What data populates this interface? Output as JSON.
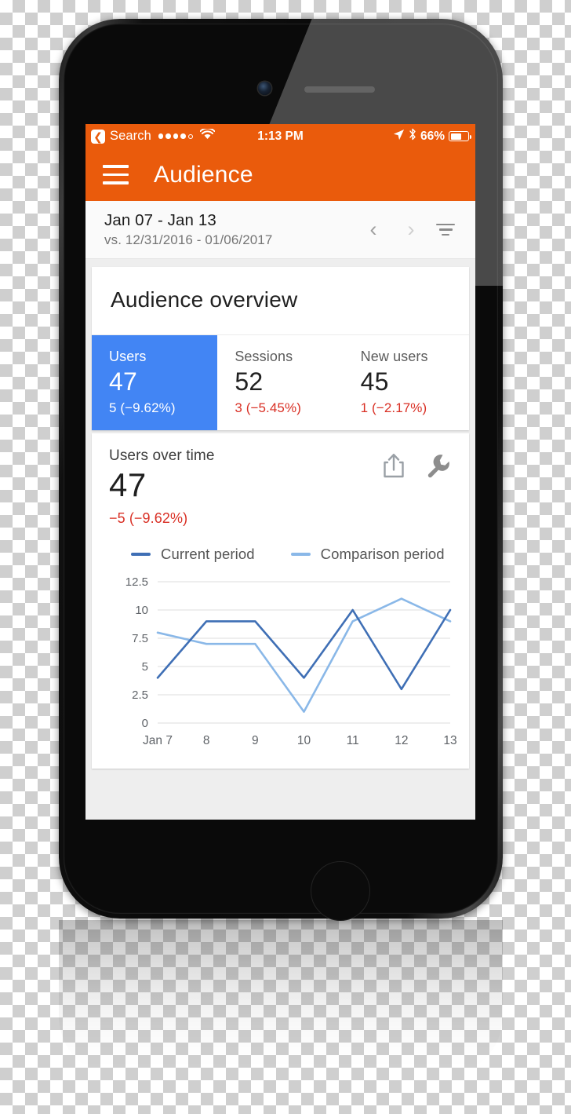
{
  "status_bar": {
    "back_label": "Search",
    "back_icon": "chevron-left-icon",
    "signal_icon": "signal-dots-icon",
    "wifi_icon": "wifi-icon",
    "time": "1:13 PM",
    "location_icon": "location-arrow-icon",
    "bluetooth_icon": "bluetooth-icon",
    "battery_percent": "66%",
    "battery_icon": "battery-icon",
    "battery_level": 66
  },
  "app_bar": {
    "menu_icon": "hamburger-menu-icon",
    "title": "Audience",
    "background_color": "#ea5b0c"
  },
  "date_bar": {
    "primary": "Jan 07 - Jan 13",
    "comparison": "vs. 12/31/2016 - 01/06/2017",
    "prev_icon": "chevron-left-icon",
    "next_icon": "chevron-right-icon",
    "filter_icon": "filter-icon"
  },
  "overview": {
    "title": "Audience overview",
    "metrics": [
      {
        "label": "Users",
        "value": "47",
        "delta": "5 (−9.62%)",
        "selected": true
      },
      {
        "label": "Sessions",
        "value": "52",
        "delta": "3 (−5.45%)",
        "selected": false
      },
      {
        "label": "New users",
        "value": "45",
        "delta": "1 (−2.17%)",
        "selected": false
      }
    ],
    "selected_color": "#4285f4",
    "negative_color": "#d93025"
  },
  "chart_card": {
    "title": "Users over time",
    "big_value": "47",
    "delta": "−5 (−9.62%)",
    "share_icon": "share-icon",
    "settings_icon": "wrench-icon"
  },
  "chart_data": {
    "type": "line",
    "title": "Users over time",
    "x": [
      "Jan 7",
      "8",
      "9",
      "10",
      "11",
      "12",
      "13"
    ],
    "categories": [
      "Jan 7",
      "8",
      "9",
      "10",
      "11",
      "12",
      "13"
    ],
    "series": [
      {
        "name": "Current period",
        "values": [
          4,
          9,
          9,
          4,
          10,
          3,
          10
        ],
        "color": "#3f6fb5"
      },
      {
        "name": "Comparison period",
        "values": [
          8,
          7,
          7,
          1,
          9,
          11,
          9
        ],
        "color": "#8ab8e8"
      }
    ],
    "legend": [
      "Current period",
      "Comparison period"
    ],
    "legend_position": "top-left",
    "yticks": [
      "0",
      "2.5",
      "5",
      "7.5",
      "10",
      "12.5"
    ],
    "ytick_values": [
      0,
      2.5,
      5,
      7.5,
      10,
      12.5
    ],
    "ylim": [
      0,
      12.5
    ],
    "xlabel": "",
    "ylabel": "",
    "grid": true
  }
}
